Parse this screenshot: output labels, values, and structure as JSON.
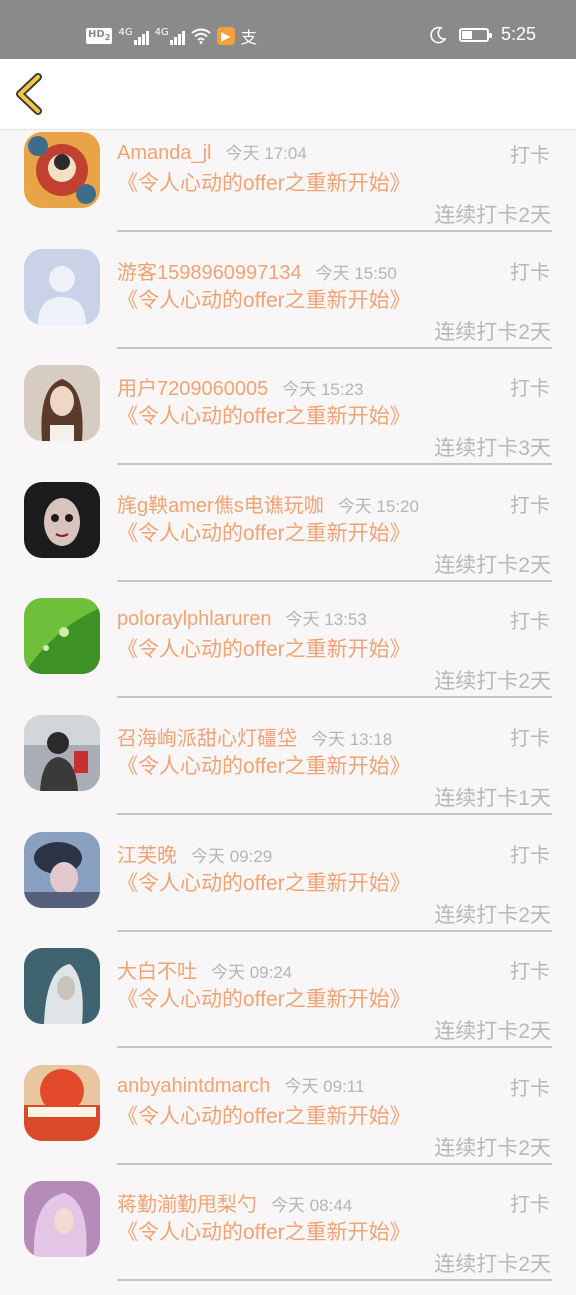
{
  "status_bar": {
    "hd_label": "HD",
    "hd_sub": "2",
    "signal1": "4G",
    "signal2": "4G",
    "app_badge": "▶",
    "pay_glyph": "支",
    "time": "5:25"
  },
  "nav": {
    "back_icon": "chevron-left-icon"
  },
  "colors": {
    "accent": "#f0a374",
    "muted": "#b8b8b8",
    "status_bar": "#8a8a8a",
    "back_icon": "#f2c93c"
  },
  "rows": [
    {
      "name": "Amanda_jl",
      "time": "今天 17:04",
      "action": "打卡",
      "title": "《令人心动的offer之重新开始》",
      "streak": "连续打卡2天"
    },
    {
      "name": "游客1598960997134",
      "time": "今天 15:50",
      "action": "打卡",
      "title": "《令人心动的offer之重新开始》",
      "streak": "连续打卡2天"
    },
    {
      "name": "用户7209060005",
      "time": "今天 15:23",
      "action": "打卡",
      "title": "《令人心动的offer之重新开始》",
      "streak": "连续打卡3天"
    },
    {
      "name": "旄g鞅amer僬s电谯玩咖",
      "time": "今天 15:20",
      "action": "打卡",
      "title": "《令人心动的offer之重新开始》",
      "streak": "连续打卡2天"
    },
    {
      "name": "poloraylphlaruren",
      "time": "今天 13:53",
      "action": "打卡",
      "title": "《令人心动的offer之重新开始》",
      "streak": "连续打卡2天"
    },
    {
      "name": "召海峋派甜心灯礓垈",
      "time": "今天 13:18",
      "action": "打卡",
      "title": "《令人心动的offer之重新开始》",
      "streak": "连续打卡1天"
    },
    {
      "name": "江芙晚",
      "time": "今天 09:29",
      "action": "打卡",
      "title": "《令人心动的offer之重新开始》",
      "streak": "连续打卡2天"
    },
    {
      "name": "大白不吐",
      "time": "今天 09:24",
      "action": "打卡",
      "title": "《令人心动的offer之重新开始》",
      "streak": "连续打卡2天"
    },
    {
      "name": "anbyahintdmarch",
      "time": "今天 09:11",
      "action": "打卡",
      "title": "《令人心动的offer之重新开始》",
      "streak": "连续打卡2天"
    },
    {
      "name": "蒋勤湔勤甩梨勺",
      "time": "今天 08:44",
      "action": "打卡",
      "title": "《令人心动的offer之重新开始》",
      "streak": "连续打卡2天"
    }
  ]
}
